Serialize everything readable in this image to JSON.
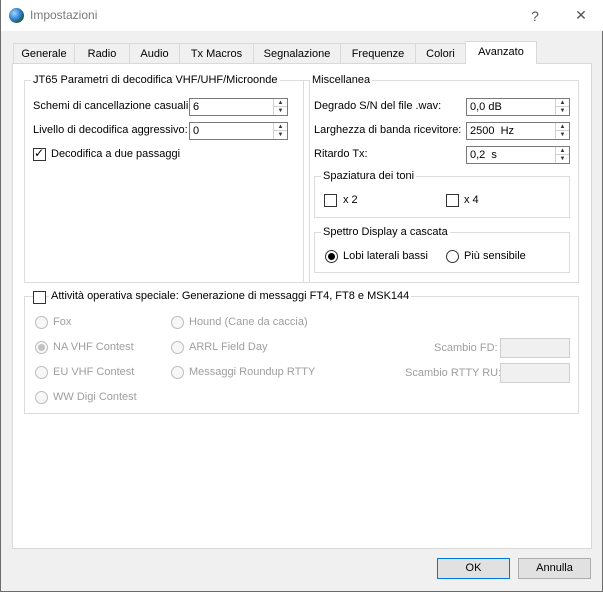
{
  "window": {
    "title": "Impostazioni",
    "help_glyph": "?",
    "close_glyph": "✕"
  },
  "tabs": [
    {
      "label": "Generale"
    },
    {
      "label": "Radio"
    },
    {
      "label": "Audio"
    },
    {
      "label": "Tx Macros"
    },
    {
      "label": "Segnalazione"
    },
    {
      "label": "Frequenze"
    },
    {
      "label": "Colori"
    },
    {
      "label": "Avanzato"
    }
  ],
  "jt65": {
    "title": "JT65 Parametri di decodifica VHF/UHF/Microonde",
    "random_erasure_label": "Schemi di cancellazione casuali:",
    "random_erasure_value": "6",
    "aggressive_label": "Livello di decodifica aggressivo:",
    "aggressive_value": "0",
    "two_pass_label": "Decodifica a due passaggi"
  },
  "misc": {
    "title": "Miscellanea",
    "degrade_label": "Degrado S/N del file .wav:",
    "degrade_value": "0,0 dB",
    "bandwidth_label": "Larghezza di banda ricevitore:",
    "bandwidth_value": "2500  Hz",
    "tx_delay_label": "Ritardo Tx:",
    "tx_delay_value": "0,2  s",
    "tone_spacing": {
      "title": "Spaziatura dei toni",
      "x2_label": "x 2",
      "x4_label": "x 4"
    },
    "waterfall": {
      "title": "Spettro Display a cascata",
      "low_sidelobes_label": "Lobi laterali bassi",
      "most_sensitive_label": "Più sensibile"
    }
  },
  "special": {
    "title": "Attività operativa speciale: Generazione di messaggi FT4, FT8 e MSK144",
    "fox_label": "Fox",
    "hound_label": "Hound (Cane da caccia)",
    "na_vhf_label": "NA VHF Contest",
    "arrl_fd_label": "ARRL Field Day",
    "fd_exchange_label": "Scambio FD:",
    "eu_vhf_label": "EU VHF Contest",
    "rtty_roundup_label": "Messaggi Roundup RTTY",
    "rtty_exchange_label": "Scambio RTTY RU:",
    "ww_digi_label": "WW Digi Contest"
  },
  "footer": {
    "ok_label": "OK",
    "cancel_label": "Annulla"
  }
}
